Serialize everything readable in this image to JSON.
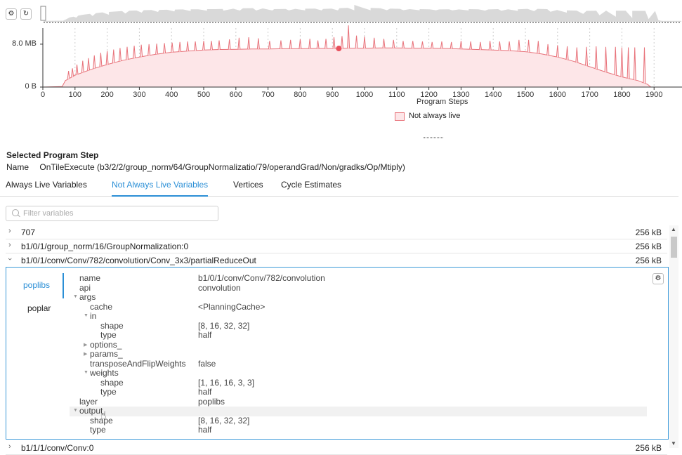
{
  "toolbar": {
    "settings_icon": "gear-icon",
    "refresh_icon": "refresh-icon"
  },
  "chart_data": {
    "type": "area",
    "title": "",
    "xlabel": "Program Steps",
    "ylabel": "",
    "xlim": [
      0,
      1950
    ],
    "ylim": [
      0,
      11
    ],
    "x_ticks": [
      "0",
      "100",
      "200",
      "300",
      "400",
      "500",
      "600",
      "700",
      "800",
      "900",
      "1000",
      "1100",
      "1200",
      "1300",
      "1400",
      "1500",
      "1600",
      "1700",
      "1800",
      "1900"
    ],
    "y_ticks": [
      "0 B",
      "8.0 MB"
    ],
    "y_tick_values": [
      0,
      8
    ],
    "legend": "bottom-center",
    "grid": "vertical-dashed",
    "series": [
      {
        "name": "Not always live",
        "color": "#e8727a",
        "fill": "#fde6e8",
        "x": [
          0,
          60,
          70,
          100,
          150,
          200,
          250,
          300,
          350,
          400,
          450,
          500,
          550,
          600,
          650,
          700,
          750,
          800,
          850,
          900,
          950,
          1000,
          1050,
          1100,
          1150,
          1200,
          1250,
          1300,
          1350,
          1400,
          1450,
          1500,
          1550,
          1600,
          1650,
          1700,
          1750,
          1800,
          1850,
          1880,
          1890,
          1950
        ],
        "y": [
          0,
          0.1,
          1.2,
          2.2,
          3.3,
          4.2,
          5.0,
          5.6,
          6.1,
          6.5,
          6.7,
          6.9,
          7.0,
          7.05,
          7.1,
          7.1,
          7.15,
          7.15,
          7.2,
          7.2,
          7.25,
          7.25,
          7.3,
          7.3,
          7.25,
          7.25,
          7.2,
          7.1,
          7.0,
          6.9,
          6.8,
          6.6,
          6.2,
          5.6,
          4.8,
          3.8,
          2.8,
          1.9,
          1.2,
          0.5,
          0,
          0
        ],
        "spikes_x": [
          80,
          92,
          106,
          124,
          142,
          160,
          180,
          200,
          220,
          240,
          262,
          284,
          306,
          330,
          354,
          378,
          402,
          426,
          450,
          474,
          500,
          524,
          548,
          580,
          610,
          640,
          670,
          705,
          740,
          770,
          800,
          830,
          855,
          880,
          905,
          930,
          950,
          975,
          1000,
          1030,
          1060,
          1090,
          1120,
          1150,
          1180,
          1210,
          1240,
          1270,
          1300,
          1330,
          1360,
          1390,
          1420,
          1450,
          1480,
          1510,
          1540,
          1570,
          1600,
          1630,
          1660,
          1690,
          1720,
          1750,
          1780,
          1800,
          1820,
          1840,
          1870
        ],
        "spikes_y": [
          3.0,
          3.5,
          4.2,
          4.9,
          5.4,
          5.9,
          6.4,
          6.7,
          7.0,
          7.3,
          7.5,
          7.7,
          7.9,
          8.0,
          8.1,
          8.2,
          8.3,
          8.4,
          8.5,
          8.5,
          8.6,
          8.6,
          8.7,
          8.9,
          9.2,
          9.3,
          9.1,
          8.6,
          8.7,
          8.8,
          8.9,
          9.0,
          8.7,
          9.0,
          9.3,
          9.5,
          11.5,
          9.6,
          9.4,
          9.2,
          9.0,
          8.8,
          8.6,
          8.6,
          8.5,
          8.4,
          8.5,
          8.4,
          8.6,
          8.5,
          8.4,
          8.6,
          8.5,
          8.5,
          8.8,
          8.8,
          8.6,
          8.0,
          7.8,
          7.6,
          7.4,
          7.5,
          7.6,
          7.5,
          7.5,
          7.4,
          7.4,
          7.4,
          7.4
        ],
        "marker": {
          "x": 920,
          "y": 7.2
        }
      }
    ],
    "overview_area": true
  },
  "legend": {
    "label": "Not always live"
  },
  "selected": {
    "title": "Selected Program Step",
    "name_label": "Name",
    "name_value": "OnTileExecute (b3/2/2/group_norm/64/GroupNormalizatio/79/operandGrad/Non/gradks/Op/Mtiply)"
  },
  "tabs": [
    {
      "label": "Always Live Variables"
    },
    {
      "label": "Not Always Live Variables"
    },
    {
      "label": "Vertices"
    },
    {
      "label": "Cycle Estimates"
    }
  ],
  "filter": {
    "placeholder": "Filter variables"
  },
  "rows": [
    {
      "name": "707",
      "size": "256 kB"
    },
    {
      "name": "b1/0/1/group_norm/16/GroupNormalization:0",
      "size": "256 kB"
    },
    {
      "name": "b1/0/1/conv/Conv/782/convolution/Conv_3x3/partialReduceOut",
      "size": "256 kB"
    },
    {
      "name": "b1/1/1/conv/Conv:0",
      "size": "256 kB"
    }
  ],
  "detail": {
    "side_tabs": [
      "poplibs",
      "poplar"
    ],
    "tree": [
      {
        "key": "name",
        "value": "b1/0/1/conv/Conv/782/convolution",
        "depth": 0
      },
      {
        "key": "api",
        "value": "convolution",
        "depth": 0
      },
      {
        "key": "args",
        "value": "",
        "depth": 0,
        "expanded": true
      },
      {
        "key": "cache",
        "value": "<PlanningCache>",
        "depth": 1
      },
      {
        "key": "in",
        "value": "",
        "depth": 1,
        "expanded": true
      },
      {
        "key": "shape",
        "value": "[8, 16, 32, 32]",
        "depth": 2
      },
      {
        "key": "type",
        "value": "half",
        "depth": 2
      },
      {
        "key": "options_",
        "value": "",
        "depth": 1,
        "collapsed": true
      },
      {
        "key": "params_",
        "value": "",
        "depth": 1,
        "collapsed": true
      },
      {
        "key": "transposeAndFlipWeights",
        "value": "false",
        "depth": 1
      },
      {
        "key": "weights",
        "value": "",
        "depth": 1,
        "expanded": true
      },
      {
        "key": "shape",
        "value": "[1, 16, 16, 3, 3]",
        "depth": 2
      },
      {
        "key": "type",
        "value": "half",
        "depth": 2
      },
      {
        "key": "layer",
        "value": "poplibs",
        "depth": 0
      },
      {
        "key": "output",
        "value": "",
        "depth": 0,
        "expanded": true
      },
      {
        "key": "shape",
        "value": "[8, 16, 32, 32]",
        "depth": 1
      },
      {
        "key": "type",
        "value": "half",
        "depth": 1
      }
    ]
  }
}
